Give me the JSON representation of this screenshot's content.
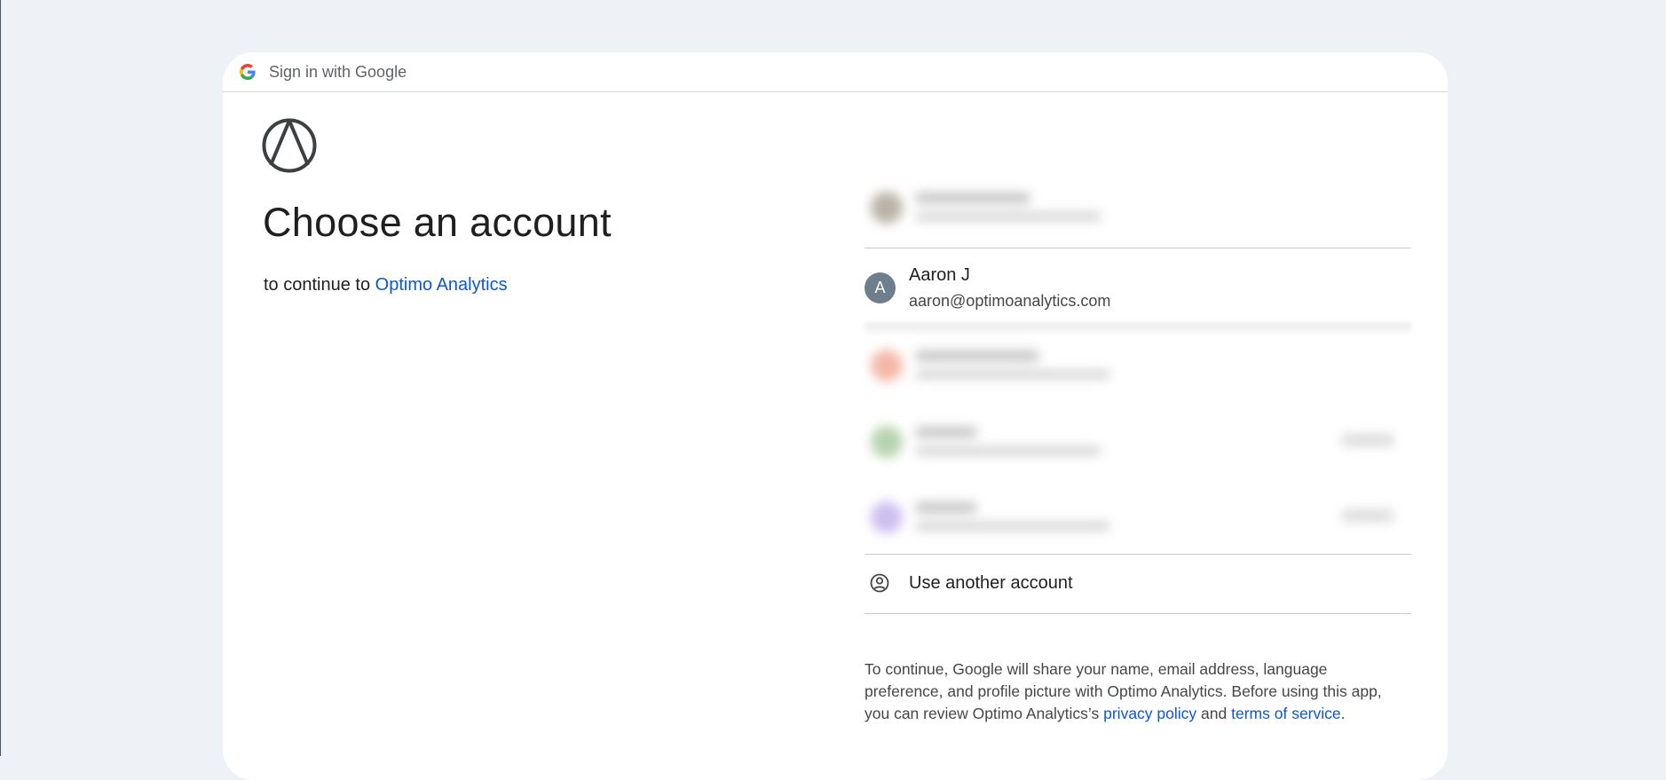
{
  "header": {
    "logo_icon": "google-g-icon",
    "title": "Sign in with Google"
  },
  "main": {
    "app_logo_icon": "optimo-analytics-logo",
    "heading": "Choose an account",
    "subtitle_prefix": "to continue to",
    "app_name": "Optimo Analytics"
  },
  "accounts": {
    "selected": {
      "avatar_initial": "A",
      "avatar_color": "#6e7e8c",
      "name": "Aaron J",
      "email": "aaron@optimoanalytics.com"
    },
    "use_another_label": "Use another account",
    "use_another_icon": "account-circle-icon"
  },
  "disclaimer": {
    "line_1": "To continue, Google will share your name, email address, language",
    "line_2": "preference, and profile picture with Optimo Analytics. Before using this app,",
    "line_3_prefix": "you can review Optimo Analytics’s",
    "privacy_link": "privacy policy",
    "conjunction": "and",
    "terms_link": "terms of service",
    "period": "."
  },
  "colors": {
    "page_background": "#eef2f6",
    "card_background": "#ffffff",
    "link": "#0b57d0",
    "text_primary": "#1f1f1f",
    "text_secondary": "#444746",
    "divider": "#c7c9cc"
  }
}
